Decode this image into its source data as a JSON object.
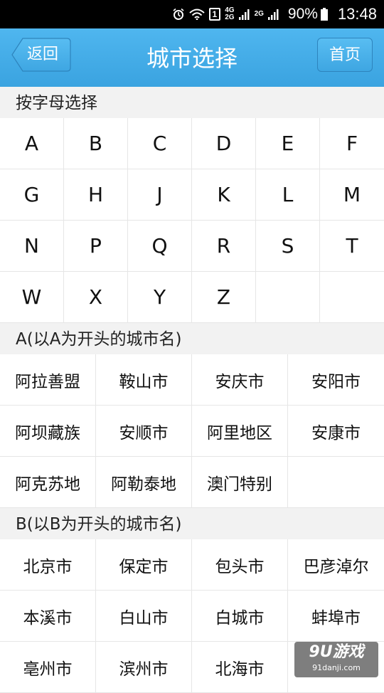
{
  "status_bar": {
    "sim_label": "1",
    "net_top": "4G",
    "net_bottom": "2G",
    "net2": "2G",
    "battery": "90%",
    "time": "13:48"
  },
  "header": {
    "back_label": "返回",
    "title": "城市选择",
    "home_label": "首页",
    "color": "#3aa3e0"
  },
  "letter_section": {
    "title": "按字母选择",
    "letters": [
      "A",
      "B",
      "C",
      "D",
      "E",
      "F",
      "G",
      "H",
      "J",
      "K",
      "L",
      "M",
      "N",
      "P",
      "Q",
      "R",
      "S",
      "T",
      "W",
      "X",
      "Y",
      "Z",
      "",
      ""
    ]
  },
  "city_sections": [
    {
      "title": "A(以A为开头的城市名)",
      "cities": [
        "阿拉善盟",
        "鞍山市",
        "安庆市",
        "安阳市",
        "阿坝藏族",
        "安顺市",
        "阿里地区",
        "安康市",
        "阿克苏地",
        "阿勒泰地",
        "澳门特别",
        ""
      ]
    },
    {
      "title": "B(以B为开头的城市名)",
      "cities": [
        "北京市",
        "保定市",
        "包头市",
        "巴彦淖尔",
        "本溪市",
        "白山市",
        "白城市",
        "蚌埠市",
        "亳州市",
        "滨州市",
        "北海市",
        ""
      ]
    }
  ],
  "watermark": {
    "logo": "9U游戏",
    "url": "91danji.com"
  }
}
